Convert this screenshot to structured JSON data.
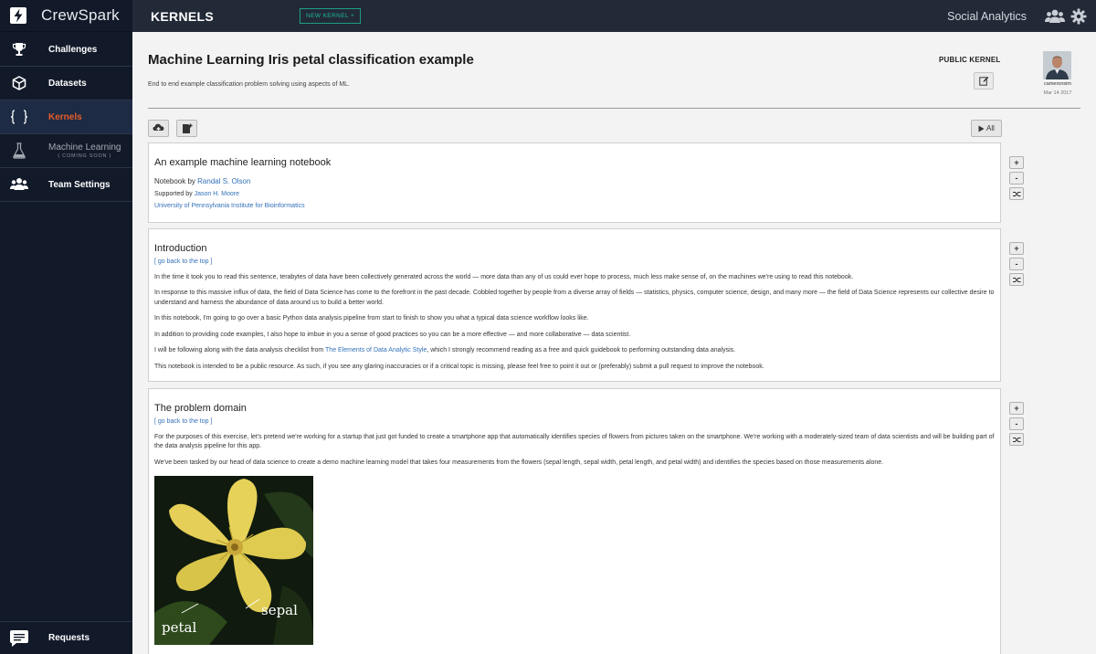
{
  "brand": {
    "name": "CrewSpark"
  },
  "sidebar": {
    "items": [
      {
        "label": "Challenges",
        "icon": "trophy-icon"
      },
      {
        "label": "Datasets",
        "icon": "cube-icon"
      },
      {
        "label": "Kernels",
        "icon": "braces-icon",
        "active": true
      },
      {
        "label": "Machine Learning",
        "sublabel": "( COMING SOON )",
        "icon": "flask-icon",
        "disabled": true
      },
      {
        "label": "Team Settings",
        "icon": "team-icon"
      }
    ],
    "requests_label": "Requests"
  },
  "topbar": {
    "title": "KERNELS",
    "new_kernel": "NEW KERNEL +",
    "social": "Social Analytics"
  },
  "kernel": {
    "title": "Machine Learning Iris petal classification example",
    "description": "End to end example classification problem solving using aspects of ML.",
    "visibility": "PUBLIC KERNEL",
    "author": "cameronsim",
    "date": "Mar 14 2017",
    "run_all": "All"
  },
  "cells": [
    {
      "heading": "An example machine learning notebook",
      "notebook_by_prefix": "Notebook by ",
      "notebook_by_name": "Randal S. Olson",
      "supported_by_prefix": "Supported by ",
      "supported_by_name": "Jason H. Moore",
      "institute": "University of Pennsylvania Institute for Bioinformatics"
    },
    {
      "heading": "Introduction",
      "back_link": "[ go back to the top ]",
      "p1": "In the time it took you to read this sentence, terabytes of data have been collectively generated across the world — more data than any of us could ever hope to process, much less make sense of, on the machines we're using to read this notebook.",
      "p2": "In response to this massive influx of data, the field of Data Science has come to the forefront in the past decade. Cobbled together by people from a diverse array of fields — statistics, physics, computer science, design, and many more — the field of Data Science represents our collective desire to understand and harness the abundance of data around us to build a better world.",
      "p3": "In this notebook, I'm going to go over a basic Python data analysis pipeline from start to finish to show you what a typical data science workflow looks like.",
      "p4": "In addition to providing code examples, I also hope to imbue in you a sense of good practices so you can be a more effective — and more collaborative — data scientist.",
      "p5_prefix": "I will be following along with the data analysis checklist from ",
      "p5_link": "The Elements of Data Analytic Style",
      "p5_suffix": ", which I strongly recommend reading as a free and quick guidebook to performing outstanding data analysis.",
      "p6": "This notebook is intended to be a public resource. As such, if you see any glaring inaccuracies or if a critical topic is missing, please feel free to point it out or (preferably) submit a pull request to improve the notebook."
    },
    {
      "heading": "The problem domain",
      "back_link": "[ go back to the top ]",
      "p1": "For the purposes of this exercise, let's pretend we're working for a startup that just got funded to create a smartphone app that automatically identifies species of flowers from pictures taken on the smartphone. We're working with a moderately-sized team of data scientists and will be building part of the data analysis pipeline for this app.",
      "p2": "We've been tasked by our head of data science to create a demo machine learning model that takes four measurements from the flowers (sepal length, sepal width, petal length, and petal width) and identifies the species based on those measurements alone.",
      "image_label_petal": "petal",
      "image_label_sepal": "sepal"
    }
  ],
  "cell_controls": {
    "add": "+",
    "remove": "-"
  }
}
